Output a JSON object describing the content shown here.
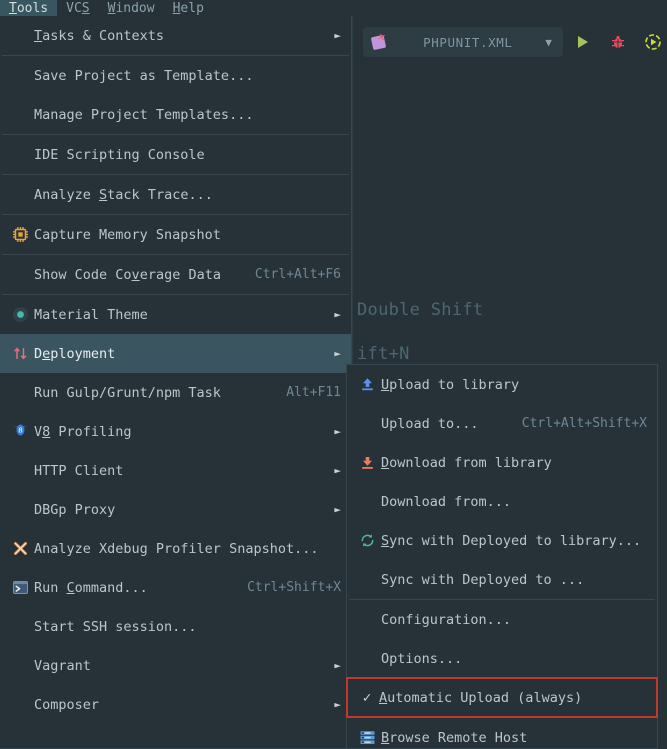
{
  "window": {
    "background_color": "#263238",
    "menu_background": "#263238",
    "selected_color": "#3b5560",
    "highlight_outline_color": "#c0392b"
  },
  "menubar": {
    "items": [
      {
        "label": "Tools",
        "mnemonic": "T",
        "active": true
      },
      {
        "label": "VCS",
        "mnemonic": "S",
        "active": false
      },
      {
        "label": "Window",
        "mnemonic": "W",
        "active": false
      },
      {
        "label": "Help",
        "mnemonic": "H",
        "active": false
      }
    ]
  },
  "toolbar": {
    "run_config_name": "PHPUNIT.XML",
    "run_config_icon": "phpunit-icon",
    "dropdown_icon": "chevron-down-icon",
    "buttons": [
      {
        "name": "run-button",
        "icon": "play-icon",
        "color": "#a5c261"
      },
      {
        "name": "debug-button",
        "icon": "bug-icon",
        "color": "#f2495c"
      },
      {
        "name": "coverage-button",
        "icon": "coverage-icon",
        "color": "#cddc39"
      }
    ]
  },
  "editor": {
    "ghost_hint_1": "Double Shift",
    "ghost_hint_2": "ift+N"
  },
  "tools_menu": {
    "items": [
      {
        "type": "item",
        "label": "Tasks & Contexts",
        "mnemonic": "T",
        "icon": null,
        "accel": "",
        "submenu": true,
        "selected": false
      },
      {
        "type": "separator"
      },
      {
        "type": "item",
        "label": "Save Project as Template...",
        "mnemonic": "",
        "icon": null,
        "accel": "",
        "submenu": false,
        "selected": false
      },
      {
        "type": "item",
        "label": "Manage Project Templates...",
        "mnemonic": "",
        "icon": null,
        "accel": "",
        "submenu": false,
        "selected": false
      },
      {
        "type": "separator"
      },
      {
        "type": "item",
        "label": "IDE Scripting Console",
        "mnemonic": "",
        "icon": null,
        "accel": "",
        "submenu": false,
        "selected": false
      },
      {
        "type": "separator"
      },
      {
        "type": "item",
        "label": "Analyze Stack Trace...",
        "mnemonic": "S",
        "icon": null,
        "accel": "",
        "submenu": false,
        "selected": false
      },
      {
        "type": "separator"
      },
      {
        "type": "item",
        "label": "Capture Memory Snapshot",
        "mnemonic": "",
        "icon": "memory-chip-icon",
        "accel": "",
        "submenu": false,
        "selected": false
      },
      {
        "type": "separator"
      },
      {
        "type": "item",
        "label": "Show Code Coverage Data",
        "mnemonic": "v",
        "icon": null,
        "accel": "Ctrl+Alt+F6",
        "submenu": false,
        "selected": false
      },
      {
        "type": "separator"
      },
      {
        "type": "item",
        "label": "Material Theme",
        "mnemonic": "",
        "icon": "material-theme-icon",
        "accel": "",
        "submenu": true,
        "selected": false
      },
      {
        "type": "item",
        "label": "Deployment",
        "mnemonic": "e",
        "icon": "deployment-arrows-icon",
        "accel": "",
        "submenu": true,
        "selected": true
      },
      {
        "type": "item",
        "label": "Run Gulp/Grunt/npm Task",
        "mnemonic": "",
        "icon": null,
        "accel": "Alt+F11",
        "submenu": false,
        "selected": false
      },
      {
        "type": "item",
        "label": "V8 Profiling",
        "mnemonic": "8",
        "icon": "v8-icon",
        "accel": "",
        "submenu": true,
        "selected": false
      },
      {
        "type": "item",
        "label": "HTTP Client",
        "mnemonic": "",
        "icon": null,
        "accel": "",
        "submenu": true,
        "selected": false
      },
      {
        "type": "item",
        "label": "DBGp Proxy",
        "mnemonic": "",
        "icon": null,
        "accel": "",
        "submenu": true,
        "selected": false
      },
      {
        "type": "item",
        "label": "Analyze Xdebug Profiler Snapshot...",
        "mnemonic": "",
        "icon": "xdebug-icon",
        "accel": "",
        "submenu": false,
        "selected": false
      },
      {
        "type": "item",
        "label": "Run Command...",
        "mnemonic": "C",
        "icon": "terminal-icon",
        "accel": "Ctrl+Shift+X",
        "submenu": false,
        "selected": false
      },
      {
        "type": "item",
        "label": "Start SSH session...",
        "mnemonic": "",
        "icon": null,
        "accel": "",
        "submenu": false,
        "selected": false
      },
      {
        "type": "item",
        "label": "Vagrant",
        "mnemonic": "",
        "icon": null,
        "accel": "",
        "submenu": true,
        "selected": false
      },
      {
        "type": "item",
        "label": "Composer",
        "mnemonic": "",
        "icon": null,
        "accel": "",
        "submenu": true,
        "selected": false
      }
    ]
  },
  "deployment_submenu": {
    "items": [
      {
        "type": "item",
        "label": "Upload to library",
        "mnemonic": "U",
        "icon": "upload-arrow-icon",
        "accel": "",
        "checked": false,
        "highlighted": false
      },
      {
        "type": "item",
        "label": "Upload to...",
        "mnemonic": "",
        "icon": null,
        "accel": "Ctrl+Alt+Shift+X",
        "checked": false,
        "highlighted": false
      },
      {
        "type": "item",
        "label": "Download from library",
        "mnemonic": "D",
        "icon": "download-arrow-icon",
        "accel": "",
        "checked": false,
        "highlighted": false
      },
      {
        "type": "item",
        "label": "Download from...",
        "mnemonic": "",
        "icon": null,
        "accel": "",
        "checked": false,
        "highlighted": false
      },
      {
        "type": "item",
        "label": "Sync with Deployed to library...",
        "mnemonic": "S",
        "icon": "sync-icon",
        "accel": "",
        "checked": false,
        "highlighted": false
      },
      {
        "type": "item",
        "label": "Sync with Deployed to ...",
        "mnemonic": "",
        "icon": null,
        "accel": "",
        "checked": false,
        "highlighted": false
      },
      {
        "type": "separator"
      },
      {
        "type": "item",
        "label": "Configuration...",
        "mnemonic": "",
        "icon": null,
        "accel": "",
        "checked": false,
        "highlighted": false
      },
      {
        "type": "item",
        "label": "Options...",
        "mnemonic": "",
        "icon": null,
        "accel": "",
        "checked": false,
        "highlighted": false
      },
      {
        "type": "item",
        "label": "Automatic Upload (always)",
        "mnemonic": "A",
        "icon": "check-icon",
        "accel": "",
        "checked": true,
        "highlighted": true
      },
      {
        "type": "separator"
      },
      {
        "type": "item",
        "label": "Browse Remote Host",
        "mnemonic": "B",
        "icon": "remote-host-icon",
        "accel": "",
        "checked": false,
        "highlighted": false
      }
    ]
  }
}
